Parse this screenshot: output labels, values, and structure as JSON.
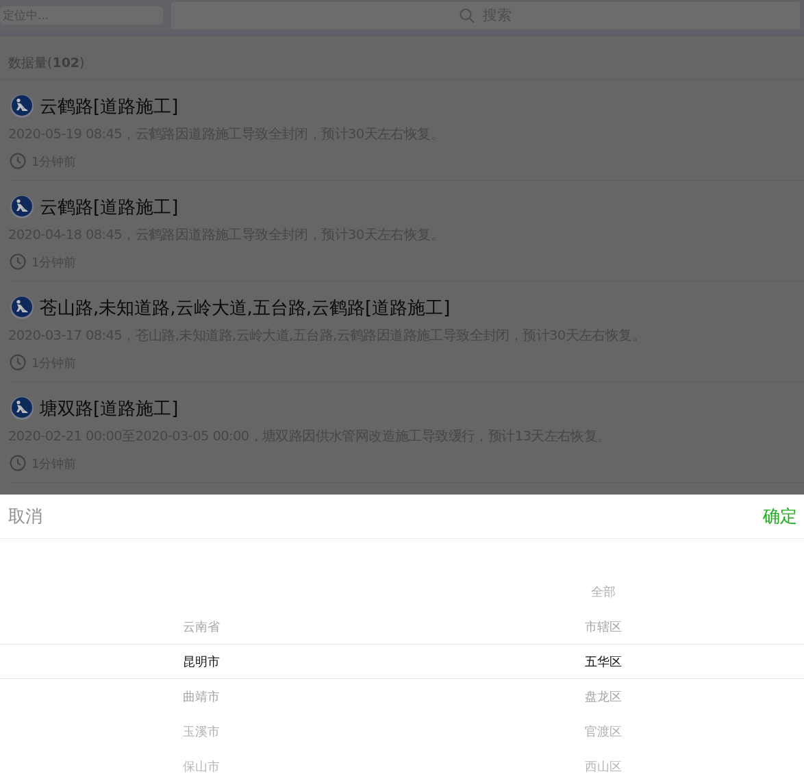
{
  "top_bar": {
    "location": "定位中...",
    "search_placeholder": "搜索"
  },
  "count": "数据量(**102**)",
  "events": [
    {
      "title": "云鹤路[道路施工]",
      "description": "2020-05-19 08:45，云鹤路因道路施工导致全封闭，预计30天左右恢复。",
      "time": "1分钟前"
    },
    {
      "title": "云鹤路[道路施工]",
      "description": "2020-04-18 08:45，云鹤路因道路施工导致全封闭，预计30天左右恢复。",
      "time": "1分钟前"
    },
    {
      "title": "苍山路,未知道路,云岭大道,五台路,云鹤路[道路施工]",
      "description": "2020-03-17 08:45，苍山路,未知道路,云岭大道,五台路,云鹤路因道路施工导致全封闭，预计30天左右恢复。",
      "time": "1分钟前"
    },
    {
      "title": "塘双路[道路施工]",
      "description": "2020-02-21 00:00至2020-03-05 00:00，塘双路因供水管网改造施工导致缓行，预计13天左右恢复。",
      "time": "1分钟前"
    }
  ],
  "picker": {
    "cancel": "取消",
    "confirm": "确定",
    "columns": [
      {
        "items": [
          {
            "label": "云南省",
            "selected": false
          },
          {
            "label": "昆明市",
            "selected": true
          },
          {
            "label": "曲靖市",
            "selected": false
          },
          {
            "label": "玉溪市",
            "selected": false
          },
          {
            "label": "保山市",
            "selected": false
          }
        ]
      },
      {
        "items": [
          {
            "label": "全部",
            "selected": false
          },
          {
            "label": "市辖区",
            "selected": false
          },
          {
            "label": "五华区",
            "selected": true
          },
          {
            "label": "盘龙区",
            "selected": false
          },
          {
            "label": "官渡区",
            "selected": false
          },
          {
            "label": "西山区",
            "selected": false
          }
        ]
      }
    ]
  }
}
